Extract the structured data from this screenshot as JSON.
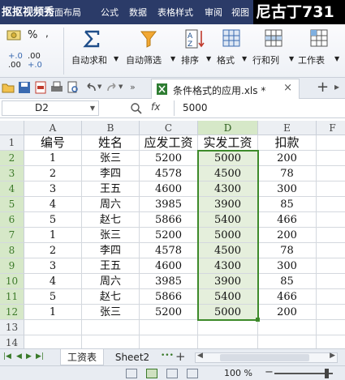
{
  "watermark_left": "抠抠视频秀",
  "watermark_right": "尼古丁731",
  "menu": [
    "页面布局",
    "公式",
    "数据",
    "表格样式",
    "审阅",
    "视图"
  ],
  "ribbon": {
    "percent": "%",
    "inc_decimal_top": "+.0",
    "inc_decimal_bottom": ".00",
    "dec_decimal_top": ".00",
    "dec_decimal_bottom": "+.0",
    "autosum": "自动求和",
    "autofilter": "自动筛选",
    "sort": "排序",
    "format": "格式",
    "rowcol": "行和列",
    "worksheet": "工作表"
  },
  "doc_tab": "条件格式的应用.xls *",
  "doc_tab_close": "×",
  "new_tab": "+",
  "name_box": "D2",
  "formula_value": "5000",
  "fx_label": "fx",
  "columns": [
    "A",
    "B",
    "C",
    "D",
    "E",
    "F"
  ],
  "rows": [
    "1",
    "2",
    "3",
    "4",
    "5",
    "6",
    "7",
    "8",
    "9",
    "10",
    "11",
    "12",
    "13",
    "14"
  ],
  "header_row": [
    "编号",
    "姓名",
    "应发工资",
    "实发工资",
    "扣款"
  ],
  "table": [
    [
      "1",
      "张三",
      "5200",
      "5000",
      "200"
    ],
    [
      "2",
      "李四",
      "4578",
      "4500",
      "78"
    ],
    [
      "3",
      "王五",
      "4600",
      "4300",
      "300"
    ],
    [
      "4",
      "周六",
      "3985",
      "3900",
      "85"
    ],
    [
      "5",
      "赵七",
      "5866",
      "5400",
      "466"
    ],
    [
      "1",
      "张三",
      "5200",
      "5000",
      "200"
    ],
    [
      "2",
      "李四",
      "4578",
      "4500",
      "78"
    ],
    [
      "3",
      "王五",
      "4600",
      "4300",
      "300"
    ],
    [
      "4",
      "周六",
      "3985",
      "3900",
      "85"
    ],
    [
      "5",
      "赵七",
      "5866",
      "5400",
      "466"
    ],
    [
      "1",
      "张三",
      "5200",
      "5000",
      "200"
    ]
  ],
  "sheets": [
    "工资表",
    "Sheet2"
  ],
  "sheet_more": "•••",
  "sheet_add": "+",
  "zoom_label": "100 %",
  "zoom_minus": "−",
  "colors": {
    "selection": "#3d8a2a",
    "menubar": "#2b3b68"
  }
}
